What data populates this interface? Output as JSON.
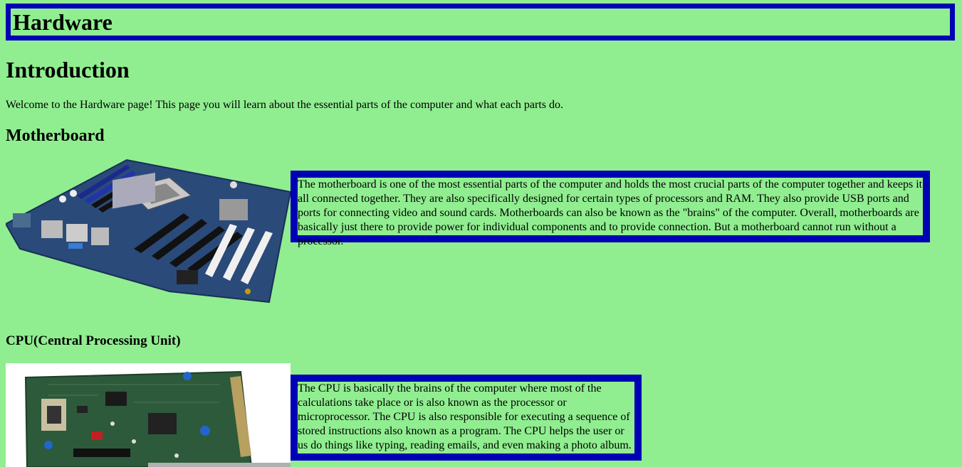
{
  "header": {
    "title": "Hardware"
  },
  "intro": {
    "heading": "Introduction",
    "text": "Welcome to the Hardware page! This page you will learn about the essential parts of the computer and what each parts do."
  },
  "motherboard": {
    "heading": "Motherboard",
    "image_icon": "motherboard-image",
    "description": "The motherboard is one of the most essential parts of the computer and holds the most crucial parts of the computer together and keeps it all connected together. They are also specifically designed for certain types of processors and RAM. They also provide USB ports and ports for connecting video and sound cards. Motherboards can also be known as the \"brains\" of the computer. Overall, motherboards are basically just there to provide power for individual components and to provide connection. But a motherboard cannot run without a processor."
  },
  "cpu": {
    "heading": "CPU(Central Processing Unit)",
    "image_icon": "circuit-board-image",
    "description": "The CPU is basically the brains of the computer where most of the calculations take place or is also known as the processor or microprocessor. The CPU is also responsible for executing a sequence of stored instructions also known as a program. The CPU helps the user or us do things like typing, reading emails, and even making a photo album."
  },
  "colors": {
    "background": "#90ee90",
    "border": "#0000b4"
  }
}
